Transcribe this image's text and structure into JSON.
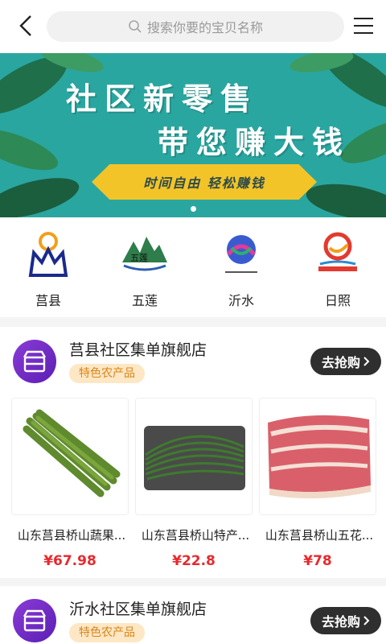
{
  "header": {
    "search_placeholder": "搜索你要的宝贝名称"
  },
  "banner": {
    "line1": "社区新零售",
    "line2": "带您赚大钱",
    "ribbon": "时间自由 轻松赚钱",
    "page_count": 1,
    "active_page": 1
  },
  "categories": [
    {
      "label": "莒县",
      "icon": "crown-sun-logo-icon"
    },
    {
      "label": "五莲",
      "icon": "mountain-logo-icon"
    },
    {
      "label": "沂水",
      "icon": "yishui-logo-icon"
    },
    {
      "label": "日照",
      "icon": "rizhao-logo-icon"
    }
  ],
  "stores": [
    {
      "name": "莒县社区集单旗舰店",
      "tag": "特色农产品",
      "button": "去抢购",
      "products": [
        {
          "name": "山东莒县桥山蔬果...",
          "price": "¥67.98",
          "image": "asparagus"
        },
        {
          "name": "山东莒县桥山特产...",
          "price": "¥22.8",
          "image": "long-beans"
        },
        {
          "name": "山东莒县桥山五花...",
          "price": "¥78",
          "image": "pork-belly"
        }
      ]
    },
    {
      "name": "沂水社区集单旗舰店",
      "tag": "特色农产品",
      "button": "去抢购"
    }
  ],
  "colors": {
    "price": "#e8292e",
    "tag_bg": "#fde7c5",
    "tag_text": "#d9861a",
    "button_bg": "#2f2f2f",
    "avatar": "#7a2fd0",
    "banner_bg": "#2aa6a0",
    "ribbon": "#f3c428"
  }
}
